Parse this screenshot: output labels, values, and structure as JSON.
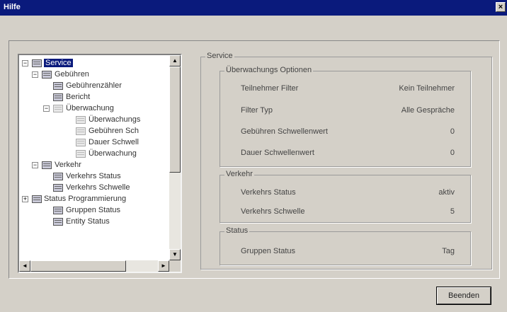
{
  "window": {
    "title": "Hilfe",
    "close_glyph": "×"
  },
  "tree": {
    "items": [
      {
        "label": "Service",
        "expander": "−",
        "icon": "table-icon",
        "selected": true
      },
      {
        "label": "Gebühren",
        "expander": "−",
        "icon": "table-icon"
      },
      {
        "label": "Gebührenzähler",
        "icon": "table-icon"
      },
      {
        "label": "Bericht",
        "icon": "table-icon"
      },
      {
        "label": "Überwachung",
        "expander": "−",
        "icon": "table-icon-gray"
      },
      {
        "label": "Überwachungs",
        "icon": "table-icon-gray"
      },
      {
        "label": "Gebühren Sch",
        "icon": "table-icon-gray"
      },
      {
        "label": "Dauer Schwell",
        "icon": "table-icon-gray"
      },
      {
        "label": "Überwachung",
        "icon": "table-icon-gray"
      },
      {
        "label": "Verkehr",
        "expander": "−",
        "icon": "table-icon"
      },
      {
        "label": "Verkehrs Status",
        "icon": "table-icon"
      },
      {
        "label": "Verkehrs Schwelle",
        "icon": "table-icon"
      },
      {
        "label": "Status Programmierung",
        "expander": "+",
        "icon": "table-icon"
      },
      {
        "label": "Gruppen Status",
        "icon": "table-icon"
      },
      {
        "label": "Entity Status",
        "icon": "table-icon"
      }
    ],
    "scroll_up": "▲",
    "scroll_down": "▼",
    "scroll_left": "◄",
    "scroll_right": "►"
  },
  "service": {
    "title": "Service",
    "monitoring": {
      "title": "Überwachungs Optionen",
      "rows": [
        {
          "label": "Teilnehmer Filter",
          "value": "Kein Teilnehmer"
        },
        {
          "label": "Filter Typ",
          "value": "Alle Gespräche"
        },
        {
          "label": "Gebühren Schwellenwert",
          "value": "0"
        },
        {
          "label": "Dauer Schwellenwert",
          "value": "0"
        }
      ]
    },
    "traffic": {
      "title": "Verkehr",
      "rows": [
        {
          "label": "Verkehrs Status",
          "value": "aktiv"
        },
        {
          "label": "Verkehrs Schwelle",
          "value": "5"
        }
      ]
    },
    "status": {
      "title": "Status",
      "rows": [
        {
          "label": "Gruppen Status",
          "value": "Tag"
        }
      ]
    }
  },
  "buttons": {
    "end": "Beenden"
  }
}
